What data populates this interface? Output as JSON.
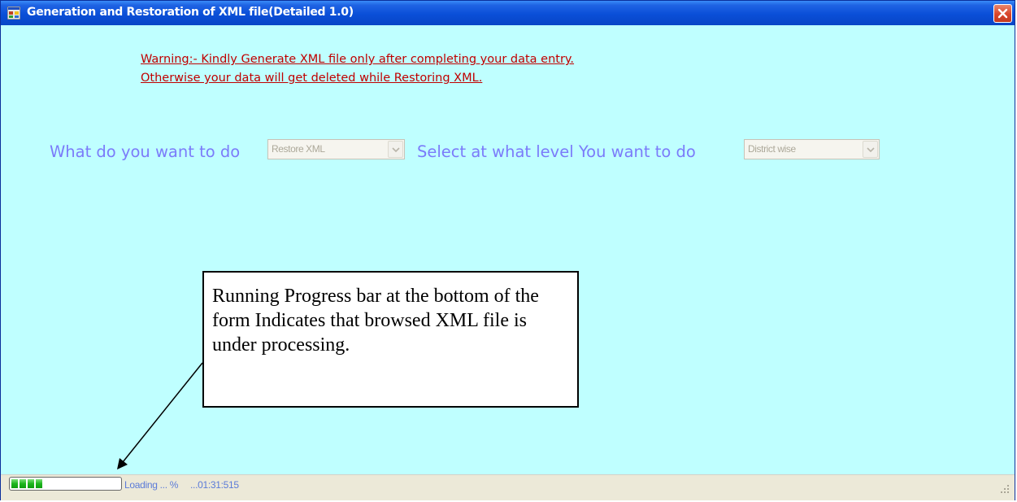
{
  "window": {
    "title": "Generation and Restoration of XML file(Detailed 1.0)"
  },
  "warning": {
    "line1": "Warning:- Kindly Generate XML file only after completing your data entry.",
    "line2": "Otherwise your data will get deleted while Restoring XML."
  },
  "form": {
    "action_label": "What do you want to do",
    "action_value": "Restore XML",
    "level_label": "Select at what level You want to do",
    "level_value": "District wise"
  },
  "callout": {
    "text": "Running Progress bar at the bottom of the form Indicates that browsed XML file is under processing."
  },
  "status": {
    "loading_text": "Loading ... %",
    "time_text": "...01:31:515",
    "progress_blocks": 4
  },
  "colors": {
    "background": "#bfffff",
    "warning": "#c00000",
    "label": "#7b7bfa",
    "titlebar": "#0a4fd8",
    "progress": "#1cb51c"
  }
}
